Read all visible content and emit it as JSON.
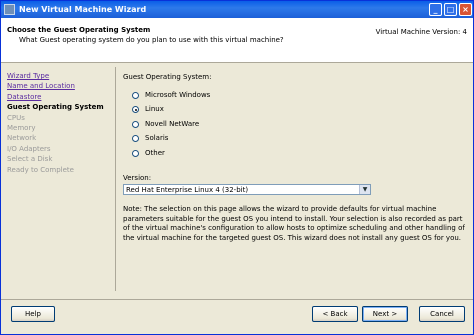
{
  "window": {
    "title": "New Virtual Machine Wizard",
    "minimize_glyph": "_",
    "maximize_glyph": "□",
    "close_glyph": "×"
  },
  "header": {
    "title": "Choose the Guest Operating System",
    "subtitle": "What Guest operating system do you plan to use with this virtual machine?",
    "version": "Virtual Machine Version: 4"
  },
  "nav": {
    "items": [
      {
        "label": "Wizard Type",
        "state": "link"
      },
      {
        "label": "Name and Location",
        "state": "link"
      },
      {
        "label": "Datastore",
        "state": "link"
      },
      {
        "label": "Guest Operating System",
        "state": "current"
      },
      {
        "label": "CPUs",
        "state": "disabled"
      },
      {
        "label": "Memory",
        "state": "disabled"
      },
      {
        "label": "Network",
        "state": "disabled"
      },
      {
        "label": "I/O Adapters",
        "state": "disabled"
      },
      {
        "label": "Select a Disk",
        "state": "disabled"
      },
      {
        "label": "Ready to Complete",
        "state": "disabled"
      }
    ]
  },
  "guest_os": {
    "label": "Guest Operating System:",
    "options": [
      {
        "label": "Microsoft Windows",
        "checked": false
      },
      {
        "label": "Linux",
        "checked": true
      },
      {
        "label": "Novell NetWare",
        "checked": false
      },
      {
        "label": "Solaris",
        "checked": false
      },
      {
        "label": "Other",
        "checked": false
      }
    ]
  },
  "version": {
    "label": "Version:",
    "selected": "Red Hat Enterprise Linux 4 (32-bit)"
  },
  "note": "Note: The selection on this page allows the wizard to provide defaults for virtual machine parameters suitable for the guest OS you intend to install. Your selection is also recorded as part of the virtual machine's configuration to allow hosts to optimize scheduling and other handling of the virtual machine for the targeted guest OS. This wizard does not install any guest OS for you.",
  "buttons": {
    "help": "Help",
    "back": "< Back",
    "next": "Next >",
    "cancel": "Cancel"
  }
}
